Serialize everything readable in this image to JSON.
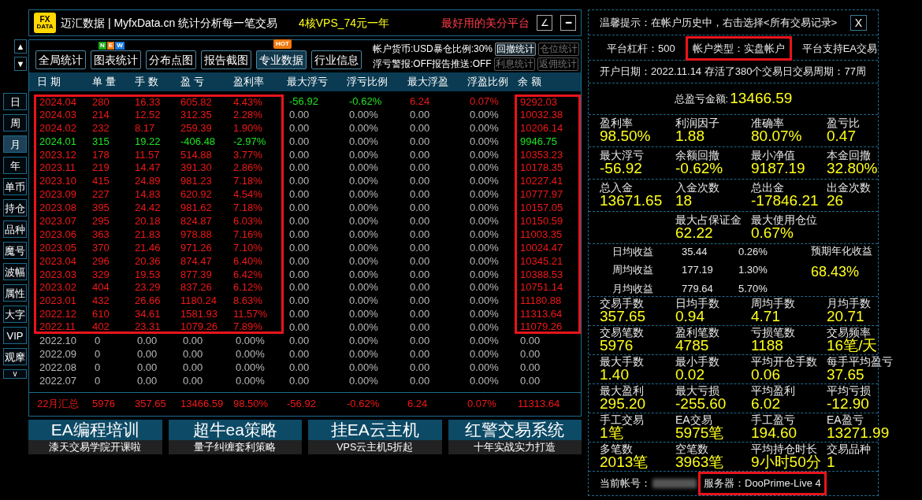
{
  "header": {
    "logo_top": "FX",
    "logo_bottom": "DATA",
    "title": "迈汇数据 | MyfxData.cn  统计分析每一笔交易",
    "promo": "4核VPS_74元一年",
    "slogan": "最好用的美分平台",
    "buttons": [
      "∠",
      "━"
    ]
  },
  "scroll_buttons": [
    "▲",
    "▼"
  ],
  "toolbar": [
    {
      "label": "全局统计"
    },
    {
      "label": "图表统计",
      "kind": "new",
      "badge": [
        "N",
        "E",
        "W"
      ]
    },
    {
      "label": "分布点图"
    },
    {
      "label": "报告截图"
    },
    {
      "label": "专业数据",
      "kind": "hot",
      "badge": [
        "HOT"
      ],
      "selected": true
    },
    {
      "label": "行业信息"
    }
  ],
  "status": [
    {
      "text": "帐户货币:USD暴仓比例:30%",
      "buttons": [
        {
          "label": "回撤统计",
          "disabled": false
        },
        {
          "label": "仓位统计",
          "disabled": true
        }
      ]
    },
    {
      "text": "浮亏警报:OFF报告推送:OFF",
      "buttons": [
        {
          "label": "利息统计",
          "disabled": true
        },
        {
          "label": "返佣统计",
          "disabled": true
        }
      ]
    }
  ],
  "side_tabs": [
    {
      "label": "日",
      "selected": false
    },
    {
      "label": "周",
      "selected": false
    },
    {
      "label": "月",
      "selected": true
    },
    {
      "label": "年",
      "selected": false
    },
    {
      "label": "单币",
      "selected": false
    },
    {
      "label": "持仓",
      "selected": false
    },
    {
      "label": "品种",
      "selected": false
    },
    {
      "label": "魔号",
      "selected": false
    },
    {
      "label": "波幅",
      "selected": false
    },
    {
      "label": "属性",
      "selected": false
    },
    {
      "label": "大字",
      "selected": false
    },
    {
      "label": "VIP",
      "selected": false
    },
    {
      "label": "观摩",
      "selected": false
    },
    {
      "label": "v",
      "selected": false
    }
  ],
  "table": {
    "columns": [
      {
        "label": "日 期",
        "boxed": true
      },
      {
        "label": "单 量",
        "boxed": true
      },
      {
        "label": "手 数",
        "boxed": true
      },
      {
        "label": "盈 亏",
        "boxed": true
      },
      {
        "label": "盈利率",
        "boxed": true
      },
      {
        "label": "最大浮亏",
        "boxed": false
      },
      {
        "label": "浮亏比例",
        "boxed": false
      },
      {
        "label": "最大浮盈",
        "boxed": false
      },
      {
        "label": "浮盈比例",
        "boxed": false
      },
      {
        "label": "余 额",
        "boxed": true
      }
    ],
    "rows": [
      {
        "color": "#f01818",
        "float_colored": true,
        "boxed": true,
        "cells": [
          "2024.04",
          "280",
          "16.33",
          "605.82",
          "4.43%",
          "-56.92",
          "-0.62%",
          "6.24",
          "0.07%",
          "9292.03"
        ]
      },
      {
        "color": "#f01818",
        "float_colored": false,
        "boxed": true,
        "cells": [
          "2024.03",
          "214",
          "12.52",
          "312.35",
          "2.28%",
          "0.00",
          "0.00%",
          "0.00",
          "0.00%",
          "10032.38"
        ]
      },
      {
        "color": "#f01818",
        "float_colored": false,
        "boxed": true,
        "cells": [
          "2024.02",
          "232",
          "8.17",
          "259.39",
          "1.90%",
          "0.00",
          "0.00%",
          "0.00",
          "0.00%",
          "10206.14"
        ]
      },
      {
        "color": "#1ee61e",
        "float_colored": false,
        "boxed": true,
        "cells": [
          "2024.01",
          "315",
          "19.22",
          "-406.48",
          "-2.97%",
          "0.00",
          "0.00%",
          "0.00",
          "0.00%",
          "9946.75"
        ]
      },
      {
        "color": "#f01818",
        "float_colored": false,
        "boxed": true,
        "cells": [
          "2023.12",
          "178",
          "11.57",
          "514.88",
          "3.77%",
          "0.00",
          "0.00%",
          "0.00",
          "0.00%",
          "10353.23"
        ]
      },
      {
        "color": "#f01818",
        "float_colored": false,
        "boxed": true,
        "cells": [
          "2023.11",
          "219",
          "14.47",
          "391.30",
          "2.86%",
          "0.00",
          "0.00%",
          "0.00",
          "0.00%",
          "10178.35"
        ]
      },
      {
        "color": "#f01818",
        "float_colored": false,
        "boxed": true,
        "cells": [
          "2023.10",
          "415",
          "24.89",
          "981.23",
          "7.18%",
          "0.00",
          "0.00%",
          "0.00",
          "0.00%",
          "10227.41"
        ]
      },
      {
        "color": "#f01818",
        "float_colored": false,
        "boxed": true,
        "cells": [
          "2023.09",
          "227",
          "14.83",
          "620.92",
          "4.54%",
          "0.00",
          "0.00%",
          "0.00",
          "0.00%",
          "10777.97"
        ]
      },
      {
        "color": "#f01818",
        "float_colored": false,
        "boxed": true,
        "cells": [
          "2023.08",
          "395",
          "24.42",
          "981.62",
          "7.18%",
          "0.00",
          "0.00%",
          "0.00",
          "0.00%",
          "10157.05"
        ]
      },
      {
        "color": "#f01818",
        "float_colored": false,
        "boxed": true,
        "cells": [
          "2023.07",
          "295",
          "20.18",
          "824.87",
          "6.03%",
          "0.00",
          "0.00%",
          "0.00",
          "0.00%",
          "10150.59"
        ]
      },
      {
        "color": "#f01818",
        "float_colored": false,
        "boxed": true,
        "cells": [
          "2023.06",
          "363",
          "21.83",
          "978.88",
          "7.16%",
          "0.00",
          "0.00%",
          "0.00",
          "0.00%",
          "11003.35"
        ]
      },
      {
        "color": "#f01818",
        "float_colored": false,
        "boxed": true,
        "cells": [
          "2023.05",
          "370",
          "21.46",
          "971.26",
          "7.10%",
          "0.00",
          "0.00%",
          "0.00",
          "0.00%",
          "10024.47"
        ]
      },
      {
        "color": "#f01818",
        "float_colored": false,
        "boxed": true,
        "cells": [
          "2023.04",
          "296",
          "20.36",
          "874.47",
          "6.40%",
          "0.00",
          "0.00%",
          "0.00",
          "0.00%",
          "10345.21"
        ]
      },
      {
        "color": "#f01818",
        "float_colored": false,
        "boxed": true,
        "cells": [
          "2023.03",
          "329",
          "19.53",
          "877.39",
          "6.42%",
          "0.00",
          "0.00%",
          "0.00",
          "0.00%",
          "10388.53"
        ]
      },
      {
        "color": "#f01818",
        "float_colored": false,
        "boxed": true,
        "cells": [
          "2023.02",
          "404",
          "23.29",
          "837.26",
          "6.12%",
          "0.00",
          "0.00%",
          "0.00",
          "0.00%",
          "10751.14"
        ]
      },
      {
        "color": "#f01818",
        "float_colored": false,
        "boxed": true,
        "cells": [
          "2023.01",
          "432",
          "26.66",
          "1180.24",
          "8.63%",
          "0.00",
          "0.00%",
          "0.00",
          "0.00%",
          "11180.88"
        ]
      },
      {
        "color": "#f01818",
        "float_colored": false,
        "boxed": true,
        "cells": [
          "2022.12",
          "610",
          "34.61",
          "1581.93",
          "11.57%",
          "0.00",
          "0.00%",
          "0.00",
          "0.00%",
          "11313.64"
        ]
      },
      {
        "color": "#f01818",
        "float_colored": false,
        "boxed": true,
        "cells": [
          "2022.11",
          "402",
          "23.31",
          "1079.26",
          "7.89%",
          "0.00",
          "0.00%",
          "0.00",
          "0.00%",
          "11079.26"
        ]
      },
      {
        "color": "#b8b8b8",
        "float_colored": false,
        "boxed": false,
        "cells": [
          "2022.10",
          "0",
          "0.00",
          "0.00",
          "0.00%",
          "0.00",
          "0.00%",
          "0.00",
          "0.00%",
          "0.00"
        ]
      },
      {
        "color": "#b8b8b8",
        "float_colored": false,
        "boxed": false,
        "cells": [
          "2022.09",
          "0",
          "0.00",
          "0.00",
          "0.00%",
          "0.00",
          "0.00%",
          "0.00",
          "0.00%",
          "0.00"
        ]
      },
      {
        "color": "#b8b8b8",
        "float_colored": false,
        "boxed": false,
        "cells": [
          "2022.08",
          "0",
          "0.00",
          "0.00",
          "0.00%",
          "0.00",
          "0.00%",
          "0.00",
          "0.00%",
          "0.00"
        ]
      },
      {
        "color": "#b8b8b8",
        "float_colored": false,
        "boxed": false,
        "cells": [
          "2022.07",
          "0",
          "0.00",
          "0.00",
          "0.00%",
          "0.00",
          "0.00%",
          "0.00",
          "0.00%",
          "0.00"
        ]
      }
    ],
    "summary": [
      "22月汇总",
      "5976",
      "357.65",
      "13466.59",
      "98.50%",
      "-56.92",
      "-0.62%",
      "6.24",
      "0.07%",
      "11313.64"
    ]
  },
  "banners": [
    {
      "title": "EA编程培训",
      "subtitle": "漆天交易学院开课啦"
    },
    {
      "title": "超牛ea策略",
      "subtitle": "量子纠缠套利策略"
    },
    {
      "title": "挂EA云主机",
      "subtitle": "VPS云主机5折起"
    },
    {
      "title": "红警交易系统",
      "subtitle": "十年实战实力打造"
    }
  ],
  "panel": {
    "tip": "温馨提示：在帐户历史中，右击选择<所有交易记录>",
    "close": "X",
    "info_row": [
      {
        "text": "平台杠杆：500",
        "boxed": false
      },
      {
        "text": "帐户类型：实盘帐户",
        "boxed": true
      },
      {
        "text": "平台支持EA交易",
        "boxed": false
      }
    ],
    "open_line": "开户日期：2022.11.14 存活了380个交易日交易周期：77周",
    "total_label": "总盈亏金额:",
    "total_value": "13466.59",
    "grid1": [
      [
        {
          "label": "盈利率",
          "value": "98.50%"
        },
        {
          "label": "利润因子",
          "value": "1.88"
        },
        {
          "label": "准确率",
          "value": "80.07%"
        },
        {
          "label": "盈亏比",
          "value": "0.47"
        }
      ],
      [
        {
          "label": "最大浮亏",
          "value": "-56.92"
        },
        {
          "label": "余额回撤",
          "value": "-0.62%"
        },
        {
          "label": "最小净值",
          "value": "9187.19"
        },
        {
          "label": "本金回撤",
          "value": "32.80%"
        }
      ],
      [
        {
          "label": "总入金",
          "value": "13671.65"
        },
        {
          "label": "入金次数",
          "value": "18"
        },
        {
          "label": "总出金",
          "value": "-17846.21"
        },
        {
          "label": "出金次数",
          "value": "26"
        }
      ]
    ],
    "margin": [
      {
        "label": "最大占保证金",
        "value": "62.22"
      },
      {
        "label": "最大使用仓位",
        "value": "0.67%"
      }
    ],
    "averages": [
      [
        "日均收益",
        "35.44",
        "0.26%"
      ],
      [
        "周均收益",
        "177.19",
        "1.30%"
      ],
      [
        "月均收益",
        "779.64",
        "5.70%"
      ]
    ],
    "annual_label": "预期年化收益",
    "annual_value": "68.43%",
    "grid2": [
      [
        {
          "label": "交易手数",
          "value": "357.65"
        },
        {
          "label": "日均手数",
          "value": "0.94"
        },
        {
          "label": "周均手数",
          "value": "4.71"
        },
        {
          "label": "月均手数",
          "value": "20.71"
        }
      ],
      [
        {
          "label": "交易笔数",
          "value": "5976"
        },
        {
          "label": "盈利笔数",
          "value": "4785"
        },
        {
          "label": "亏损笔数",
          "value": "1188"
        },
        {
          "label": "交易频率",
          "value": "16笔/天"
        }
      ],
      [
        {
          "label": "最大手数",
          "value": "1.40"
        },
        {
          "label": "最小手数",
          "value": "0.02"
        },
        {
          "label": "平均开仓手数",
          "value": "0.06"
        },
        {
          "label": "每手平均盈亏",
          "value": "37.65"
        }
      ],
      [
        {
          "label": "最大盈利",
          "value": "295.20"
        },
        {
          "label": "最大亏损",
          "value": "-255.60"
        },
        {
          "label": "平均盈利",
          "value": "6.02"
        },
        {
          "label": "平均亏损",
          "value": "-12.90"
        }
      ],
      [
        {
          "label": "手工交易",
          "value": "1笔"
        },
        {
          "label": "EA交易",
          "value": "5975笔"
        },
        {
          "label": "手工盈亏",
          "value": "194.60"
        },
        {
          "label": "EA盈亏",
          "value": "13271.99"
        }
      ],
      [
        {
          "label": "多笔数",
          "value": "2013笔"
        },
        {
          "label": "空笔数",
          "value": "3963笔"
        },
        {
          "label": "平均持仓时长",
          "value": "9小时50分"
        },
        {
          "label": "交易品种",
          "value": "1"
        }
      ]
    ],
    "account_label": "当前帐号：",
    "server": {
      "text": "服务器：DooPrime-Live 4",
      "boxed": true
    }
  }
}
